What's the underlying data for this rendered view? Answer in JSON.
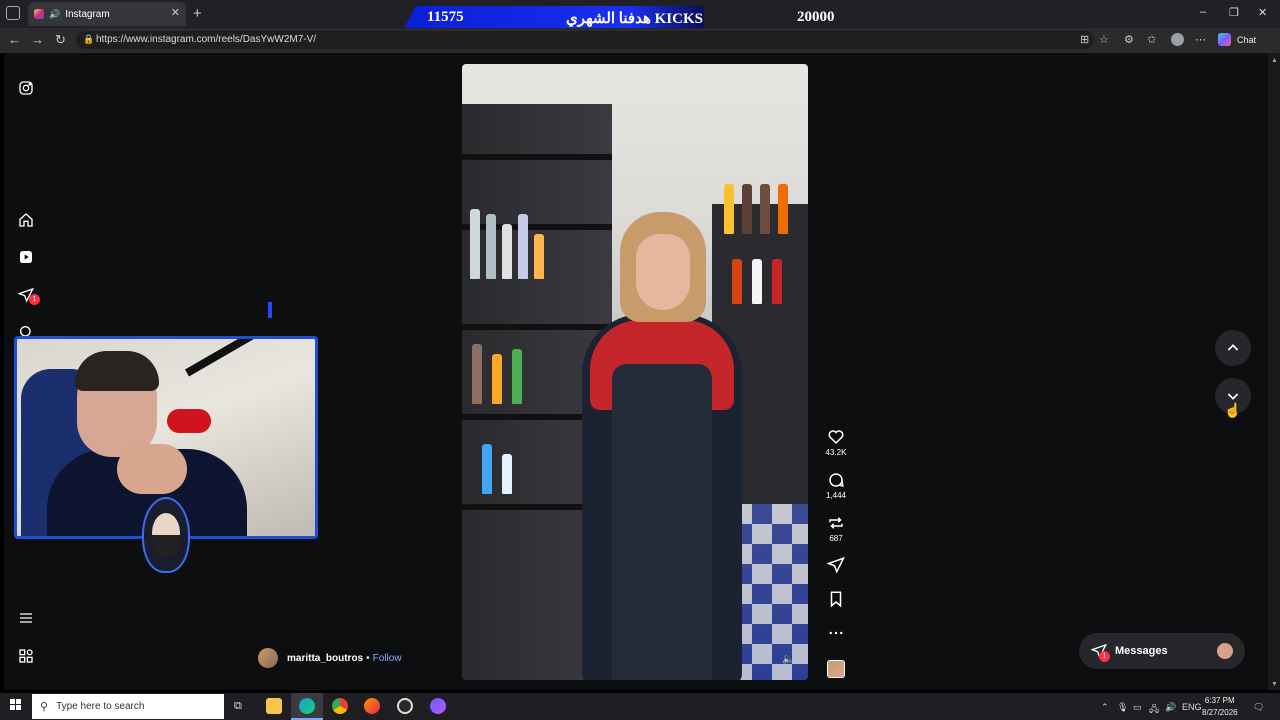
{
  "browser": {
    "tab_title": "Instagram",
    "tab_close": "✕",
    "new_tab": "+",
    "url": "https://www.instagram.com/reels/DasYwW2M7-V/",
    "copilot_label": "Chat",
    "window_controls": [
      "–",
      "❐",
      "✕"
    ]
  },
  "stream_overlay": {
    "kicks_current": "11575",
    "kicks_goal_text": "هدفنا الشهري KICKS",
    "kicks_goal": "20000"
  },
  "reel": {
    "author": "maritta_boutros",
    "separator": "•",
    "follow_label": "Follow",
    "likes": "43.2K",
    "comments": "1,444",
    "reposts": "687"
  },
  "messages": {
    "label": "Messages",
    "badge": "1"
  },
  "notifications_badge": "1",
  "taskbar": {
    "search_placeholder": "Type here to search",
    "language": "ENG",
    "time": "6:37 PM",
    "date": "8/27/2026"
  }
}
